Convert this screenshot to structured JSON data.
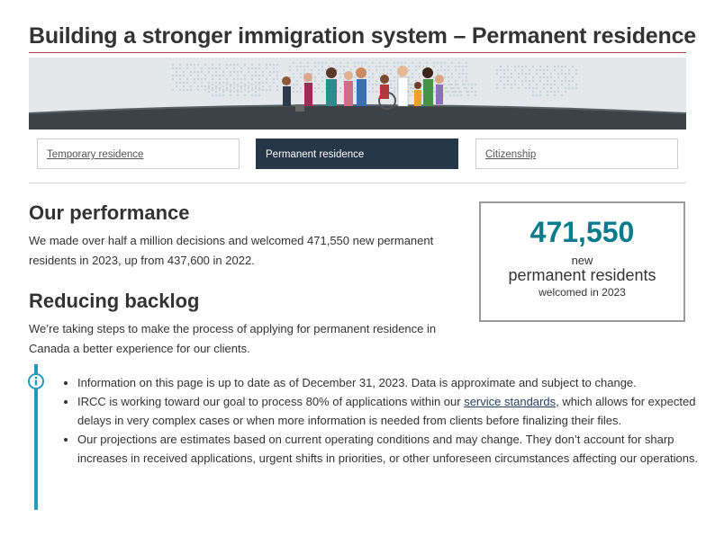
{
  "page": {
    "title": "Building a stronger immigration system – Permanent residence"
  },
  "tabs": [
    {
      "label": "Temporary residence",
      "active": false
    },
    {
      "label": "Permanent residence",
      "active": true
    },
    {
      "label": "Citizenship",
      "active": false
    }
  ],
  "performance": {
    "heading": "Our performance",
    "text": "We made over half a million decisions and welcomed 471,550 new permanent residents in 2023, up from 437,600 in 2022."
  },
  "stat": {
    "number": "471,550",
    "line1": "new",
    "line2": "permanent residents",
    "line3": "welcomed in 2023"
  },
  "backlog": {
    "heading": "Reducing backlog",
    "text": "We’re taking steps to make the process of applying for permanent residence in Canada a better experience for our clients."
  },
  "notes": {
    "icon": "info-icon",
    "items": [
      {
        "text": "Information on this page is up to date as of December 31, 2023. Data is approximate and subject to change."
      },
      {
        "before": "IRCC is working toward our goal to process 80% of applications within our ",
        "link": "service standards",
        "after": ", which allows for expected delays in very complex cases or when more information is needed from clients before finalizing their files."
      },
      {
        "text": "Our projections are estimates based on current operating conditions and may change. They don’t account for sharp increases in received applications, urgent shifts in priorities, or other unforeseen circumstances affecting our operations."
      }
    ]
  },
  "colors": {
    "accent": "#0b7c8c",
    "active_tab": "#26374a",
    "title_rule": "#af3c43",
    "info_bar": "#269abc"
  }
}
